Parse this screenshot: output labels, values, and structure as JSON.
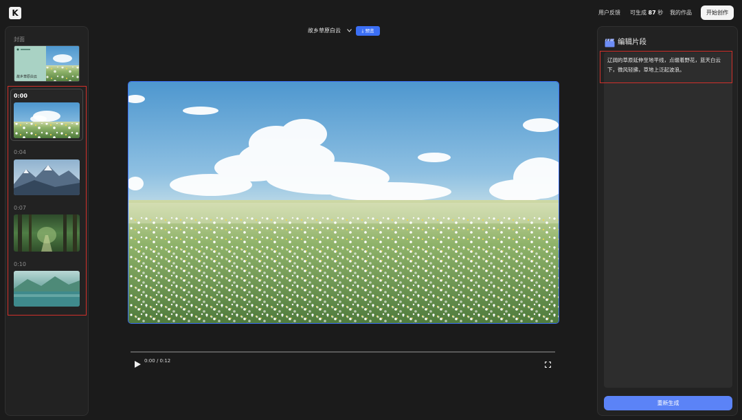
{
  "app": {
    "logo_text": "K"
  },
  "header": {
    "feedback_label": "用户反馈",
    "credits_prefix": "可生成",
    "credits_value": "87",
    "credits_unit": "秒",
    "my_works_label": "我的作品",
    "create_label": "开始创作"
  },
  "left_panel": {
    "cover_label": "封面",
    "cover_title": "故乡草原白云",
    "clips": [
      {
        "time": "0:00",
        "active": true,
        "scene": "meadow"
      },
      {
        "time": "0:04",
        "active": false,
        "scene": "mountains"
      },
      {
        "time": "0:07",
        "active": false,
        "scene": "forest"
      },
      {
        "time": "0:10",
        "active": false,
        "scene": "lake"
      }
    ]
  },
  "center": {
    "project_title": "故乡草原白云",
    "preview_label": "预览",
    "time_readout": "0:00 / 0:12",
    "playback_progress": 0
  },
  "right_panel": {
    "title": "编辑片段",
    "segment_text": "辽阔的草原延伸至地平线，点缀着野花，蓝天白云下，微风轻拂，草地上泛起波浪。",
    "regenerate_label": "重新生成"
  },
  "colors": {
    "accent": "#3b6ff5",
    "highlight_box": "#d3312b"
  }
}
